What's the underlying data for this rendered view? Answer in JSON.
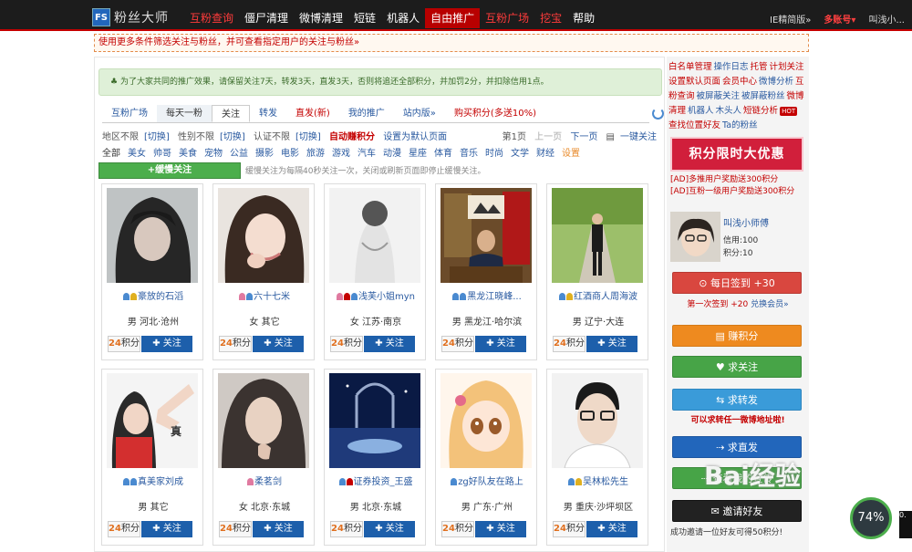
{
  "brand": {
    "logo_mark": "FS",
    "name": "粉丝大师"
  },
  "nav": [
    {
      "label": "互粉查询",
      "style": "hl"
    },
    {
      "label": "僵尸清理",
      "style": ""
    },
    {
      "label": "微博清理",
      "style": ""
    },
    {
      "label": "短链",
      "style": ""
    },
    {
      "label": "机器人",
      "style": ""
    },
    {
      "label": "自由推广",
      "style": "act"
    },
    {
      "label": "互粉广场",
      "style": "hl"
    },
    {
      "label": "挖宝",
      "style": "hl"
    },
    {
      "label": "帮助",
      "style": ""
    }
  ],
  "topright": {
    "browser_mode": "IE精简版»",
    "accounts": "多账号▾",
    "user": "叫浅小..."
  },
  "banner": "使用更多条件筛选关注与粉丝，并可查看指定用户的关注与粉丝»",
  "notice": "为了大家共同的推广效果，请保留关注7天，转发3天，直发3天，否则将追还全部积分，并加罚2分，并扣除信用1点。",
  "tabs": [
    {
      "label": "互粉广场",
      "style": ""
    },
    {
      "label": "每天一粉",
      "style": "gray"
    },
    {
      "label": "关注",
      "style": "sel"
    },
    {
      "label": "转发",
      "style": ""
    },
    {
      "label": "直发(新)",
      "style": "red"
    },
    {
      "label": "我的推广",
      "style": ""
    },
    {
      "label": "站内版»",
      "style": ""
    },
    {
      "label": "购买积分(多送10%)",
      "style": "red"
    }
  ],
  "filters": {
    "region": "地区不限",
    "region_switch": "[切换]",
    "gender": "性别不限",
    "gender_switch": "[切换]",
    "verify": "认证不限",
    "verify_switch": "[切换]",
    "auto_earn": "自动赚积分",
    "set_default": "设置为默认页面",
    "page": "第1页",
    "prev": "上一页",
    "next": "下一页",
    "one_click": "一键关注"
  },
  "categories": [
    "全部",
    "美女",
    "帅哥",
    "美食",
    "宠物",
    "公益",
    "摄影",
    "电影",
    "旅游",
    "游戏",
    "汽车",
    "动漫",
    "星座",
    "体育",
    "音乐",
    "时尚",
    "文学",
    "财经",
    "设置"
  ],
  "slow_follow": {
    "button": "+缓慢关注",
    "note": "缓慢关注为每隔40秒关注一次，关闭或刷新页面即停止缓慢关注。"
  },
  "cards": [
    {
      "name": "豪放的石滔",
      "location": "男 河北·沧州",
      "points": "24",
      "points_unit": "积分",
      "follow": "✚ 关注",
      "icon_colors": [
        "#4a8ad0",
        "#e0b020"
      ],
      "photo": "dark"
    },
    {
      "name": "六十七米",
      "location": "女 其它",
      "points": "24",
      "points_unit": "积分",
      "follow": "✚ 关注",
      "icon_colors": [
        "#e07aa0",
        "#4a8ad0"
      ],
      "photo": "girl"
    },
    {
      "name": "浅芙小姐myn",
      "location": "女 江苏·南京",
      "points": "24",
      "points_unit": "积分",
      "follow": "✚ 关注",
      "icon_colors": [
        "#e07aa0",
        "#c40000",
        "#4a8ad0"
      ],
      "photo": "bw"
    },
    {
      "name": "黑龙江晓峰...",
      "location": "男 黑龙江·哈尔滨",
      "points": "24",
      "points_unit": "积分",
      "follow": "✚ 关注",
      "icon_colors": [
        "#4a8ad0",
        "#4a8ad0"
      ],
      "photo": "office"
    },
    {
      "name": "红酒商人周海波",
      "location": "男 辽宁·大连",
      "points": "24",
      "points_unit": "积分",
      "follow": "✚ 关注",
      "icon_colors": [
        "#4a8ad0",
        "#e0b020"
      ],
      "photo": "road"
    },
    {
      "name": "真美家刘成",
      "location": "男 其它",
      "points": "24",
      "points_unit": "积分",
      "follow": "✚ 关注",
      "icon_colors": [
        "#4a8ad0",
        "#4a8ad0"
      ],
      "photo": "hand"
    },
    {
      "name": "柔茗剑",
      "location": "女 北京·东城",
      "points": "24",
      "points_unit": "积分",
      "follow": "✚ 关注",
      "icon_colors": [
        "#e07aa0"
      ],
      "photo": "woman"
    },
    {
      "name": "证券投资_王盛",
      "location": "男 北京·东城",
      "points": "24",
      "points_unit": "积分",
      "follow": "✚ 关注",
      "icon_colors": [
        "#4a8ad0",
        "#c40000"
      ],
      "photo": "night"
    },
    {
      "name": "zg好队友在路上",
      "location": "男 广东·广州",
      "points": "24",
      "points_unit": "积分",
      "follow": "✚ 关注",
      "icon_colors": [
        "#4a8ad0"
      ],
      "photo": "anime"
    },
    {
      "name": "吴林松先生",
      "location": "男 重庆·沙坪坝区",
      "points": "24",
      "points_unit": "积分",
      "follow": "✚ 关注",
      "icon_colors": [
        "#4a8ad0",
        "#e0b020"
      ],
      "photo": "glasses"
    }
  ],
  "side_links": [
    {
      "text": "白名单管理",
      "c": "r"
    },
    {
      "text": "操作日志",
      "c": "b"
    },
    {
      "text": "托管",
      "c": "r"
    },
    {
      "text": "计划关注",
      "c": "r"
    },
    {
      "text": "设置默认页面",
      "c": "r"
    },
    {
      "text": "会员中心",
      "c": "r"
    },
    {
      "text": "微博分析",
      "c": "b"
    },
    {
      "text": "互粉查询",
      "c": "r"
    },
    {
      "text": "被屏蔽关注",
      "c": "b"
    },
    {
      "text": "被屏蔽粉丝",
      "c": "b"
    },
    {
      "text": "微博清理",
      "c": "r"
    },
    {
      "text": "机器人",
      "c": "b"
    },
    {
      "text": "木头人",
      "c": "b"
    },
    {
      "text": "短链分析",
      "c": "r"
    },
    {
      "text": "查找位置好友",
      "c": "r",
      "hot": true
    },
    {
      "text": "Ta的粉丝",
      "c": "b"
    }
  ],
  "promo": "积分限时大优惠",
  "ads": [
    "[AD]多推用户奖励送300积分",
    "[AD]互粉一级用户奖励送300积分"
  ],
  "profile": {
    "name": "叫浅小师傅",
    "credit": "信用:100",
    "points": "积分:10"
  },
  "side_buttons": {
    "checkin": "⊙ 每日签到 +30",
    "checkin_note": "第一次签到 +20",
    "checkin_note2": "兑换会员»",
    "earn": "▤ 赚积分",
    "req_follow": "♥ 求关注",
    "req_repost": "⇆ 求转发",
    "repost_note": "可以求转任一微博地址啦!",
    "req_comment": "⇢ 求直发",
    "my_work": "⇢ 查看我的宣传",
    "invite": "✉ 邀请好友",
    "invite_note": "成功邀请一位好友可得50积分!"
  },
  "watermark": "Bai经验",
  "gauge": "74%",
  "edge_note": "0."
}
